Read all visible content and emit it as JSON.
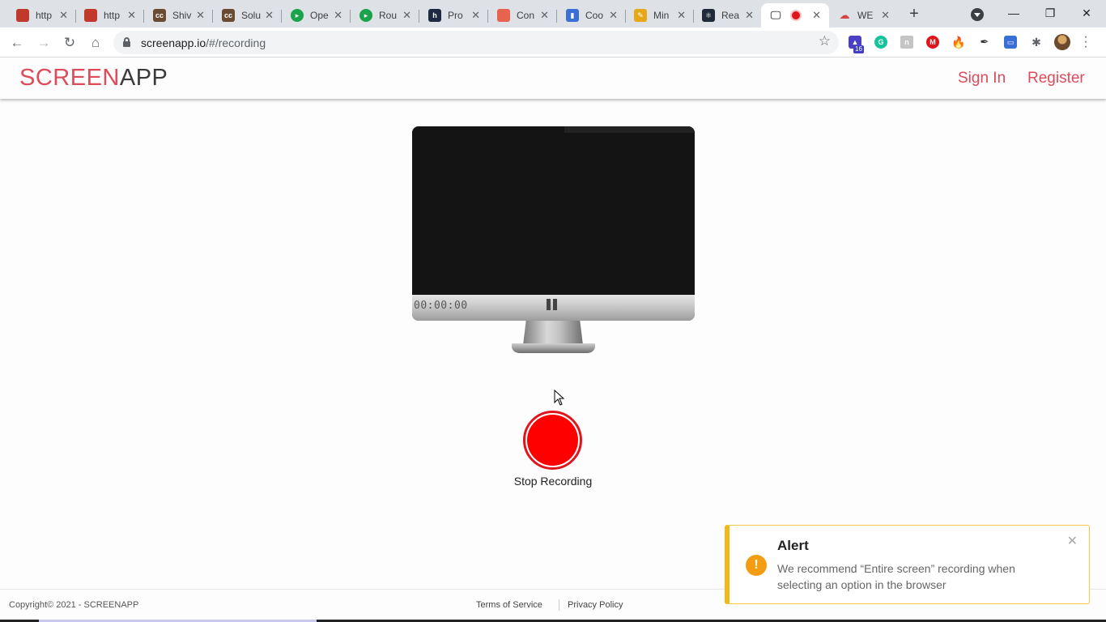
{
  "browser": {
    "tabs": [
      {
        "title": "http",
        "favicon": "red-box-icon",
        "color": "#c0392b"
      },
      {
        "title": "http",
        "favicon": "red-box-icon",
        "color": "#c0392b"
      },
      {
        "title": "Shiv",
        "favicon": "cc-icon",
        "color": "#6b4a32"
      },
      {
        "title": "Solu",
        "favicon": "cc-icon",
        "color": "#6b4a32"
      },
      {
        "title": "Ope",
        "favicon": "green-shield-icon",
        "color": "#1aa34a"
      },
      {
        "title": "Rou",
        "favicon": "green-shield-icon",
        "color": "#1aa34a"
      },
      {
        "title": "Pro",
        "favicon": "h-icon",
        "color": "#1e2a44"
      },
      {
        "title": "Con",
        "favicon": "book-icon",
        "color": "#e8634f"
      },
      {
        "title": "Coo",
        "favicon": "bar-chart-icon",
        "color": "#3b6fd4"
      },
      {
        "title": "Min",
        "favicon": "pencil-icon",
        "color": "#e6a817"
      },
      {
        "title": "Rea",
        "favicon": "react-icon",
        "color": "#1f2a38"
      },
      {
        "title": "",
        "favicon": "monitor-icon",
        "color": "#5f6368",
        "active": true
      },
      {
        "title": "WE",
        "favicon": "cloud-icon",
        "color": "#d64545"
      }
    ],
    "new_tab": "+",
    "url_host": "screenapp.io",
    "url_path": "/#/recording",
    "extension_badge": "16"
  },
  "site": {
    "logo_part1": "SCREEN",
    "logo_part2": "APP",
    "nav": {
      "sign_in": "Sign In",
      "register": "Register"
    }
  },
  "recorder": {
    "timer": "00:00:00",
    "record_label": "Stop Recording"
  },
  "footer": {
    "copyright": "Copyright©   2021 - SCREENAPP",
    "terms": "Terms of Service",
    "privacy": "Privacy Policy"
  },
  "alert": {
    "title": "Alert",
    "message": "We recommend “Entire screen” recording when selecting an option in the browser",
    "icon": "!"
  },
  "colors": {
    "brand": "#de4b5a",
    "record": "#ff0000",
    "alert_accent": "#f3b817"
  }
}
